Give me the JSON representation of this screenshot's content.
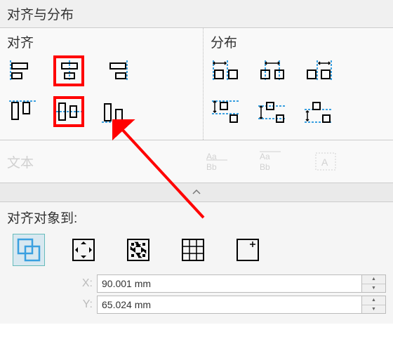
{
  "panel_title": "对齐与分布",
  "align_section_title": "对齐",
  "distribute_section_title": "分布",
  "text_section_label": "文本",
  "target_section_label": "对齐对象到:",
  "coords": {
    "x_label": "X:",
    "y_label": "Y:",
    "x_value": "90.001 mm",
    "y_value": "65.024 mm"
  },
  "highlighted_buttons": [
    "align-center-horizontal",
    "align-center-vertical"
  ],
  "selected_target": "active-objects",
  "text_align_icons": [
    "Aa Bb",
    "Aa Bb",
    "A"
  ]
}
